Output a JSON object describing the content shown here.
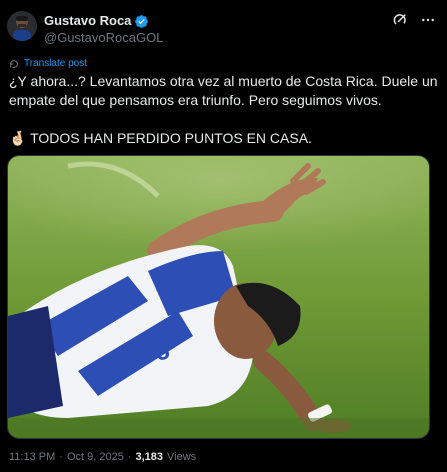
{
  "author": {
    "display_name": "Gustavo Roca",
    "handle": "@GustavoRocaGOL",
    "verified": true
  },
  "top_actions": [
    "grok-icon",
    "more-icon"
  ],
  "translate_link": "Translate post",
  "tweet": {
    "line1": "¿Y ahora...? Levantamos otra vez al muerto de Costa Rica. Duele un empate del que pensamos era triunfo. Pero seguimos vivos.",
    "line2": "TODOS HAN PERDIDO PUNTOS EN CASA.",
    "line2_emoji": "🤞🏻"
  },
  "media": {
    "description_icon": "photo-icon",
    "colors": {
      "grass": "#5f8f2b",
      "jersey_blue": "#2d4fb5",
      "jersey_white": "#f2f4f8"
    }
  },
  "footer": {
    "time": "11:13 PM",
    "separator": "·",
    "date": "Oct 9, 2025",
    "separator2": "·",
    "views_count": "3,183",
    "views_label": "Views"
  },
  "colors": {
    "accent": "#1d9bf0",
    "background": "#000000",
    "muted": "#71767b",
    "text": "#e7e9ea"
  }
}
